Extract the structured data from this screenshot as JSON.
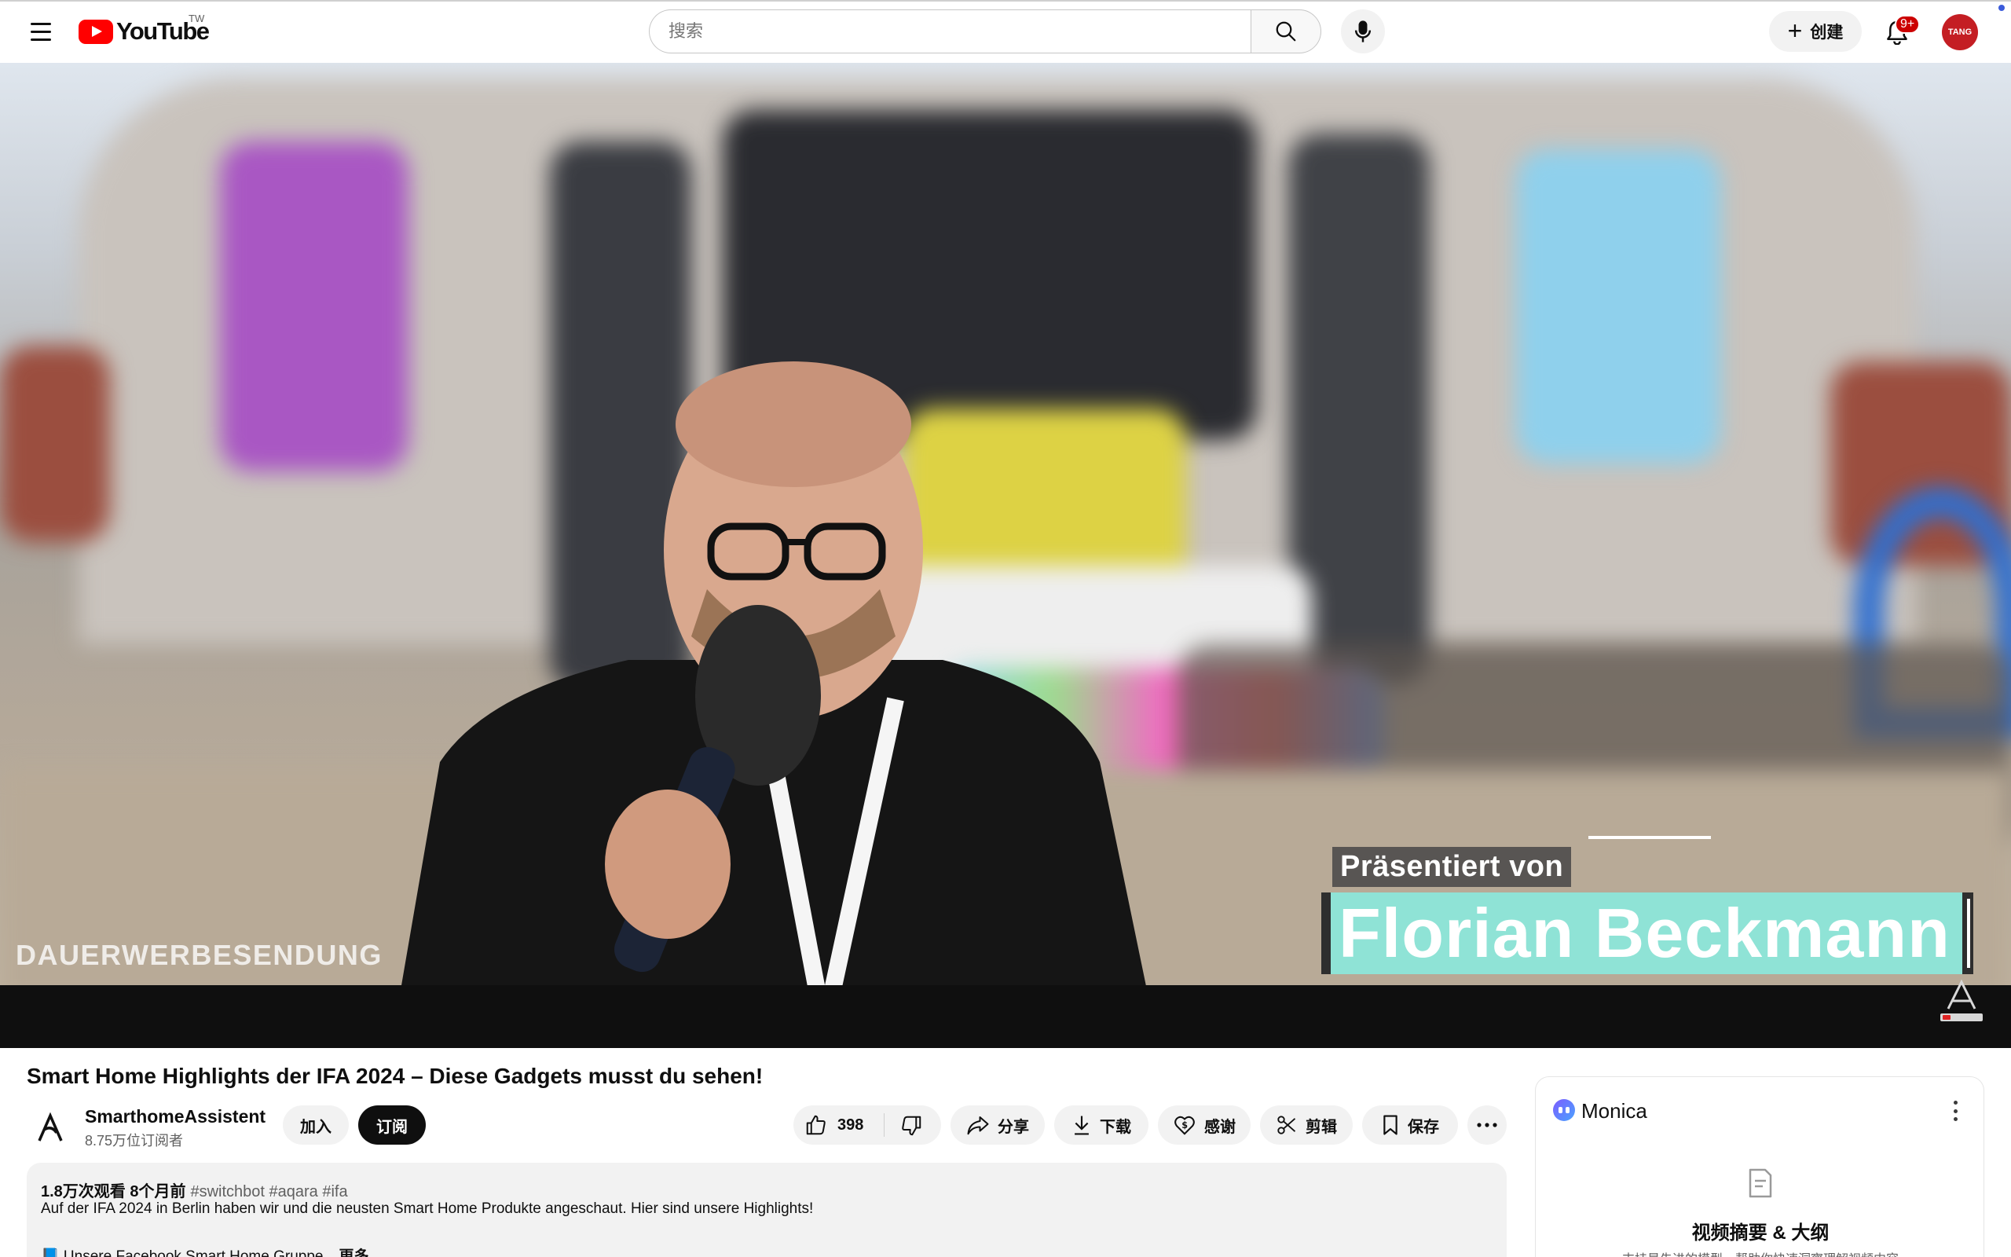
{
  "header": {
    "logo_text": "YouTube",
    "region": "TW",
    "search_placeholder": "搜索",
    "create_label": "创建",
    "notification_count": "9+",
    "avatar_text": "TANG"
  },
  "video": {
    "overlay_presented": "Präsentiert von",
    "overlay_name": "Florian Beckmann",
    "overlay_corner": "DAUERWERBESENDUNG"
  },
  "title": "Smart Home Highlights der IFA 2024 – Diese Gadgets musst du sehen!",
  "channel": {
    "name": "SmarthomeAssistent",
    "subscribers": "8.75万位订阅者",
    "join_label": "加入",
    "subscribe_label": "订阅"
  },
  "actions": {
    "like_count": "398",
    "share": "分享",
    "download": "下载",
    "thanks": "感谢",
    "clip": "剪辑",
    "save": "保存"
  },
  "description": {
    "views_time": "1.8万次观看  8个月前",
    "hashtags": "#switchbot #aqara #ifa",
    "line1": "Auf der IFA 2024 in Berlin haben wir und die neusten Smart Home Produkte angeschaut. Hier sind unsere Highlights!",
    "line2": "📘 Unsere Facebook Smart Home Gruppe",
    "more": "更多"
  },
  "monica": {
    "name": "Monica",
    "heading": "视频摘要 & 大纲",
    "sub": "支持最先进的模型，帮助你快速洞察理解视频内容"
  }
}
